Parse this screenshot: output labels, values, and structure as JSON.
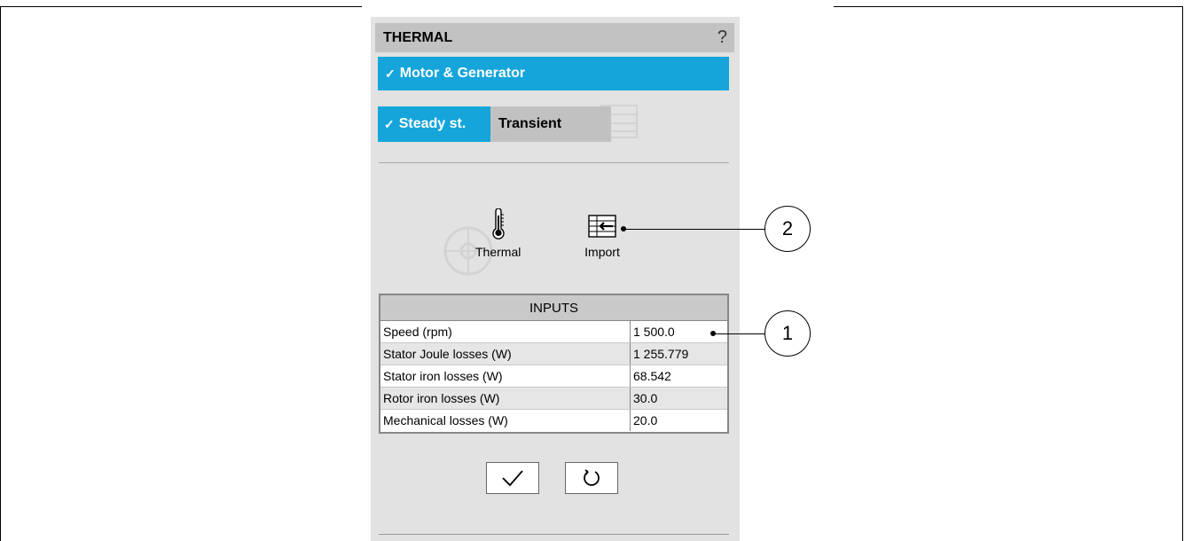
{
  "panel": {
    "title": "THERMAL",
    "help_symbol": "?",
    "application": {
      "label": "Motor & Generator",
      "checked": true
    },
    "modes": [
      {
        "label": "Steady st.",
        "active": true
      },
      {
        "label": "Transient",
        "active": false
      }
    ],
    "tools": [
      {
        "label": "Thermal",
        "icon": "thermometer-icon"
      },
      {
        "label": "Import",
        "icon": "import-table-icon"
      }
    ],
    "inputs": {
      "title": "INPUTS",
      "rows": [
        {
          "label": "Speed (rpm)",
          "value": "1 500.0"
        },
        {
          "label": "Stator Joule losses (W)",
          "value": "1 255.779"
        },
        {
          "label": "Stator iron losses (W)",
          "value": "68.542"
        },
        {
          "label": "Rotor iron losses (W)",
          "value": "30.0"
        },
        {
          "label": "Mechanical losses (W)",
          "value": "20.0"
        }
      ]
    },
    "actions": [
      {
        "name": "apply",
        "icon": "checkmark-icon"
      },
      {
        "name": "reset",
        "icon": "refresh-icon"
      }
    ]
  },
  "callouts": [
    "1",
    "2"
  ],
  "colors": {
    "accent": "#15a5db",
    "panel_bg": "#e2e2e2",
    "header_bg": "#c2c2c2",
    "inactive_tab": "#c1c1c1"
  }
}
